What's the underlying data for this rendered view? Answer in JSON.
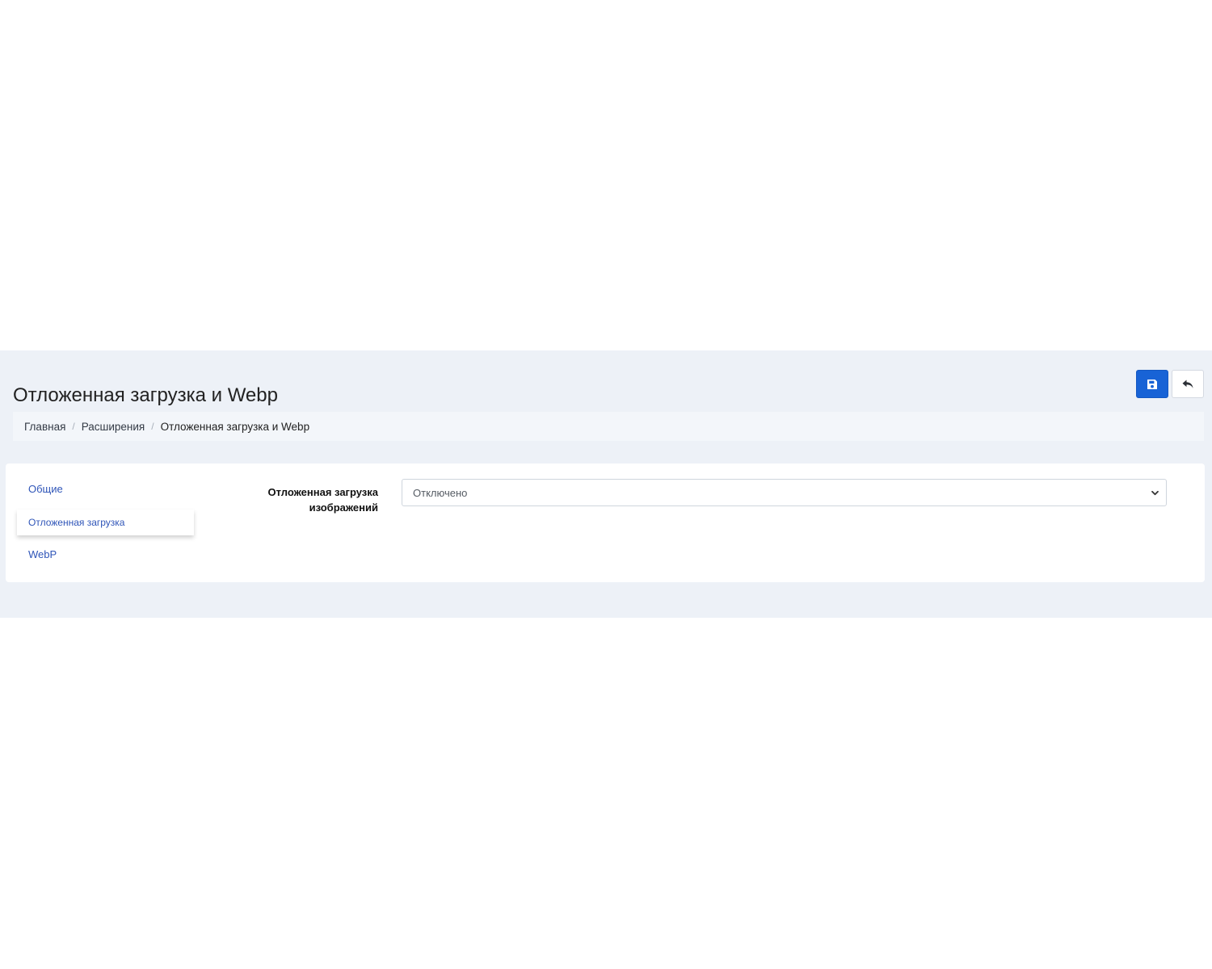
{
  "header": {
    "title": "Отложенная загрузка и Webp"
  },
  "toolbar": {
    "save_icon": "floppy-disk-icon",
    "back_icon": "reply-arrow-icon",
    "save_color": "#1863d6"
  },
  "breadcrumb": {
    "items": [
      {
        "label": "Главная"
      },
      {
        "label": "Расширения"
      },
      {
        "label": "Отложенная загрузка и Webp"
      }
    ],
    "separator": "/"
  },
  "sidebar": {
    "items": [
      {
        "label": "Общие",
        "active": false
      },
      {
        "label": "Отложенная загрузка",
        "active": true
      },
      {
        "label": "WebP",
        "active": false
      }
    ]
  },
  "form": {
    "lazy_load": {
      "label": "Отложенная загрузка изображений",
      "value": "Отключено"
    }
  },
  "colors": {
    "band_background": "#edf1f7",
    "link": "#2f55b8"
  }
}
